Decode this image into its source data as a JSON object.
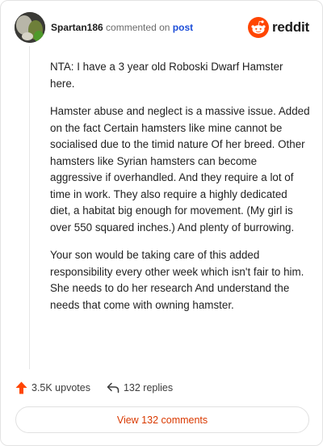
{
  "comment": {
    "username": "Spartan186",
    "action_text": "commented on",
    "target_link": "post",
    "paragraphs": [
      "NTA: I have a 3 year old Roboski Dwarf Hamster here.",
      "Hamster abuse and neglect is a massive issue. Added on the fact Certain hamsters like mine cannot be socialised due to the timid nature Of her breed. Other hamsters like Syrian hamsters can become aggressive if overhandled. And they require a lot of time in work. They also require a highly dedicated diet, a habitat big enough for movement. (My girl is over 550 squared inches.) And plenty of burrowing.",
      "Your son would be taking care of this added responsibility every other week which isn't fair to him. She needs to do her research And understand the needs that come with owning hamster."
    ]
  },
  "brand": {
    "wordmark": "reddit",
    "color": "#ff4500"
  },
  "actions": {
    "upvotes_label": "3.5K upvotes",
    "replies_label": "132 replies",
    "upvote_color": "#ff4500"
  },
  "footer": {
    "view_comments_label": "View 132 comments",
    "link_color": "#d93900"
  },
  "icons": {
    "avatar": "avatar",
    "logo": "reddit-logo-icon",
    "upvote": "upvote-arrow-icon",
    "reply": "reply-arrow-icon"
  }
}
